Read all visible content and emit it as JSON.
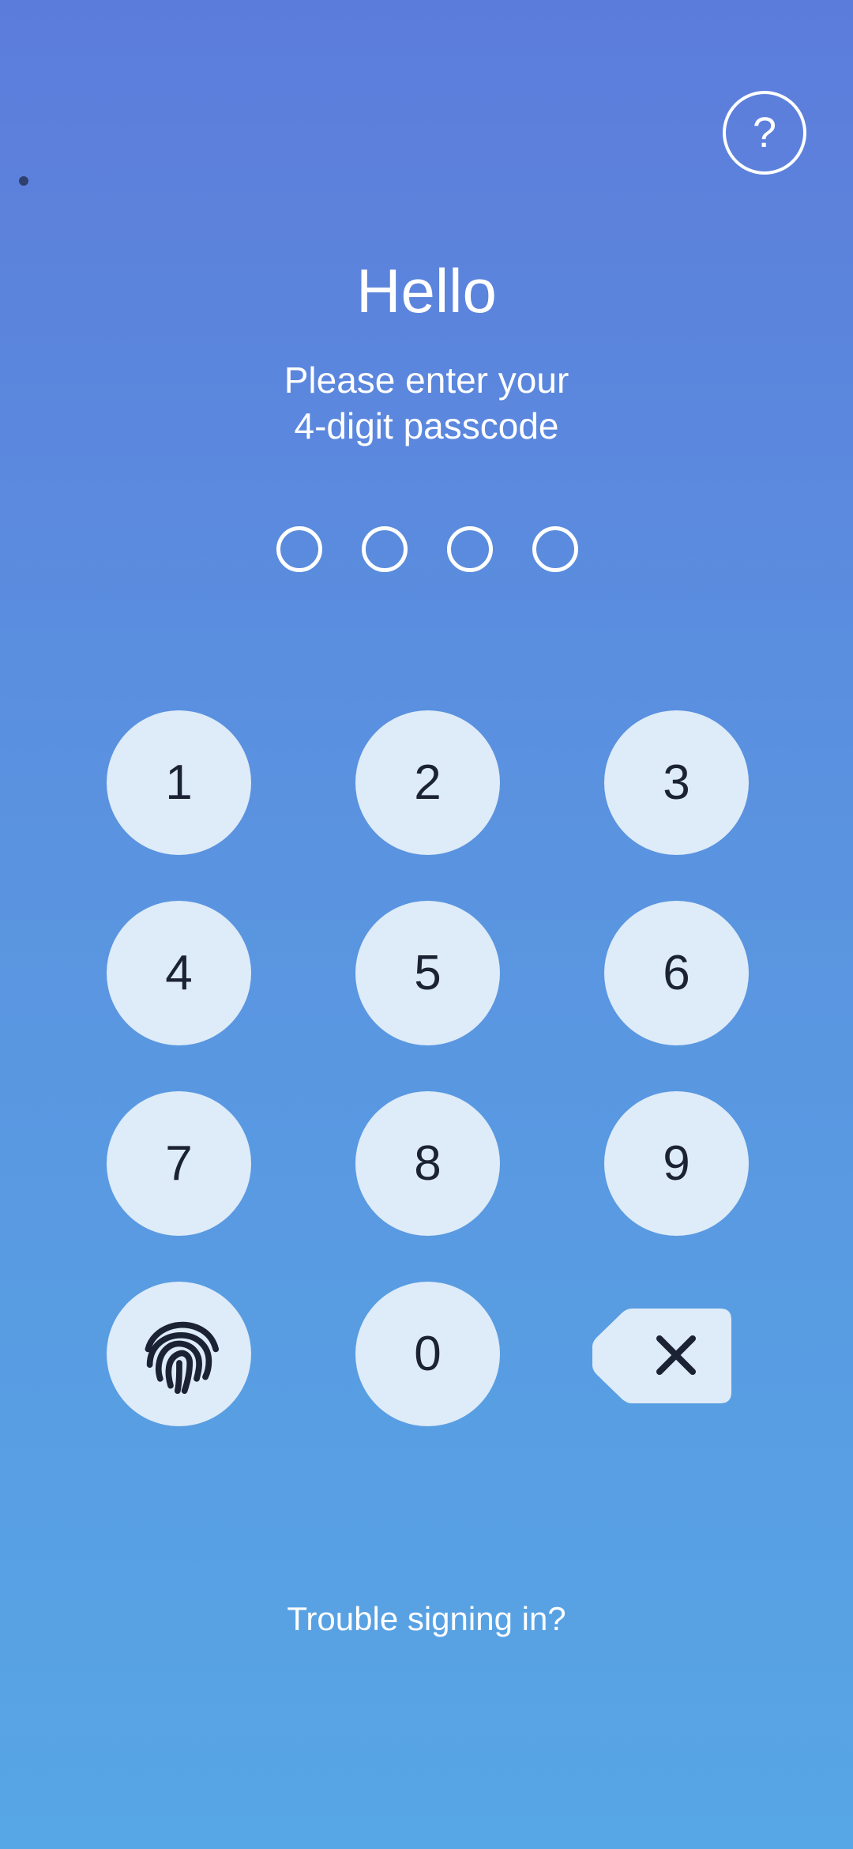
{
  "header": {
    "help_icon": "question-mark-icon",
    "help_label": "?"
  },
  "greeting": {
    "title": "Hello",
    "subtitle_line1": "Please enter your",
    "subtitle_line2": "4-digit passcode"
  },
  "passcode": {
    "length": 4,
    "entered": 0
  },
  "keypad": {
    "keys": [
      "1",
      "2",
      "3",
      "4",
      "5",
      "6",
      "7",
      "8",
      "9",
      "0"
    ],
    "fingerprint_icon": "fingerprint-icon",
    "backspace_icon": "backspace-icon"
  },
  "footer": {
    "trouble_link": "Trouble signing in?"
  },
  "colors": {
    "background_top": "#5c7cdb",
    "background_bottom": "#57a6e5",
    "key_fill": "#deebf8",
    "key_text": "#1b2233"
  }
}
